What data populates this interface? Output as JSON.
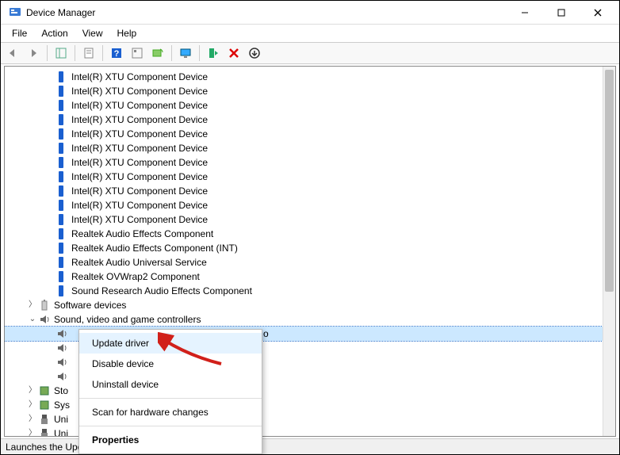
{
  "window": {
    "title": "Device Manager"
  },
  "menubar": [
    "File",
    "Action",
    "View",
    "Help"
  ],
  "toolbar_icons": [
    "back-icon",
    "forward-icon",
    "show-hide-tree-icon",
    "properties-icon",
    "help-icon",
    "options-icon",
    "scan-icon",
    "monitor-icon",
    "enable-icon",
    "disable-icon",
    "uninstall-icon"
  ],
  "tree": {
    "components": [
      "Intel(R) XTU Component Device",
      "Intel(R) XTU Component Device",
      "Intel(R) XTU Component Device",
      "Intel(R) XTU Component Device",
      "Intel(R) XTU Component Device",
      "Intel(R) XTU Component Device",
      "Intel(R) XTU Component Device",
      "Intel(R) XTU Component Device",
      "Intel(R) XTU Component Device",
      "Intel(R) XTU Component Device",
      "Intel(R) XTU Component Device",
      "Realtek Audio Effects Component",
      "Realtek Audio Effects Component (INT)",
      "Realtek Audio Universal Service",
      "Realtek OVWrap2 Component",
      "Sound Research Audio Effects Component"
    ],
    "categories": [
      {
        "label": "Software devices",
        "expanded": false,
        "icon": "chip"
      },
      {
        "label": "Sound, video and game controllers",
        "expanded": true,
        "icon": "speaker"
      },
      {
        "label": "Sto",
        "expanded": false,
        "icon": "chip"
      },
      {
        "label": "Sys",
        "expanded": false,
        "icon": "chip"
      },
      {
        "label": "Uni",
        "expanded": false,
        "icon": "usb"
      },
      {
        "label": "Uni",
        "expanded": false,
        "icon": "usb"
      }
    ],
    "selected_device_partial": "o",
    "sound_children_count": 4
  },
  "context_menu": {
    "items": [
      {
        "label": "Update driver",
        "hover": true
      },
      {
        "label": "Disable device"
      },
      {
        "label": "Uninstall device"
      },
      {
        "sep": true
      },
      {
        "label": "Scan for hardware changes"
      },
      {
        "sep": true
      },
      {
        "label": "Properties",
        "bold": true
      }
    ]
  },
  "statusbar": "Launches the Update Driver Wizard for the selected device.",
  "annotation": {
    "arrow_color": "#d1201a"
  }
}
